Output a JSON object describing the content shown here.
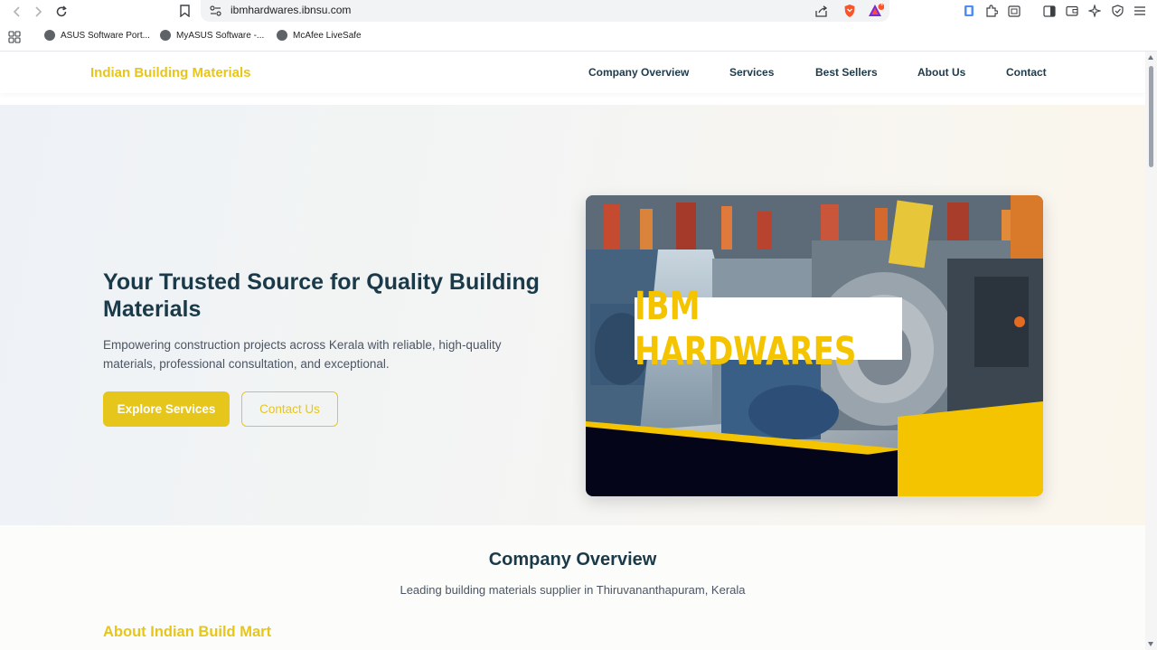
{
  "browser": {
    "url": "ibmhardwares.ibnsu.com",
    "bookmarks": [
      "ASUS Software Port...",
      "MyASUS Software -...",
      "McAfee LiveSafe"
    ],
    "notification_count": "1"
  },
  "site": {
    "logo": "Indian Building Materials",
    "nav": [
      "Company Overview",
      "Services",
      "Best Sellers",
      "About Us",
      "Contact"
    ]
  },
  "hero": {
    "title": "Your Trusted Source for Quality Building Materials",
    "subtitle": "Empowering construction projects across Kerala with reliable, high-quality materials, professional consultation, and exceptional.",
    "primary_button": "Explore Services",
    "secondary_button": "Contact Us",
    "image_brand_text": "IBM HARDWARES"
  },
  "overview": {
    "title": "Company Overview",
    "subtitle": "Leading building materials supplier in Thiruvananthapuram, Kerala",
    "about_heading": "About Indian Build Mart"
  },
  "colors": {
    "accent": "#e6c61a",
    "heading": "#1a3a4a",
    "banner_yellow": "#f5c400",
    "banner_dark": "#05051a"
  }
}
